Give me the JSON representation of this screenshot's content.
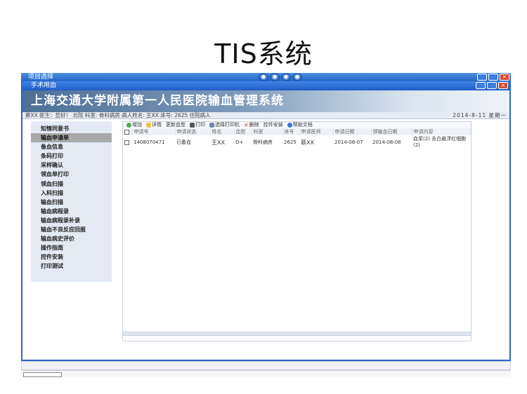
{
  "slide": {
    "title": "TIS系统"
  },
  "outer_window": {
    "title": "项目选择"
  },
  "inner_window": {
    "title": "手术用血"
  },
  "banner": {
    "text": "上海交通大学附属第一人民医院输血管理系统"
  },
  "infobar": {
    "text": "蔡XX 医生：您好！   北院  科室: 骨科病房  病人姓名: 王XX   床号: 2625  住院病人",
    "date": "2014-8-11 星期一"
  },
  "sidebar": {
    "items": [
      {
        "label": "知情同意书",
        "active": false
      },
      {
        "label": "输血申请单",
        "active": true
      },
      {
        "label": "备血信息",
        "active": false
      },
      {
        "label": "条码打印",
        "active": false
      },
      {
        "label": "采样确认",
        "active": false
      },
      {
        "label": "领血单打印",
        "active": false
      },
      {
        "label": "领血扫描",
        "active": false
      },
      {
        "label": "入科扫描",
        "active": false
      },
      {
        "label": "输血扫描",
        "active": false
      },
      {
        "label": "输血病程录",
        "active": false
      },
      {
        "label": "输血病程录补录",
        "active": false
      },
      {
        "label": "输血不良反应回报",
        "active": false
      },
      {
        "label": "输血病史评价",
        "active": false
      },
      {
        "label": "操作指南",
        "active": false
      },
      {
        "label": "控件安装",
        "active": false
      },
      {
        "label": "打印测试",
        "active": false
      }
    ]
  },
  "toolbar": {
    "add": "增加",
    "detail": "详情",
    "update_blood": "更新血型",
    "print": "打印",
    "select_printer": "选择打印机",
    "delete": "删除",
    "install": "控件安装",
    "help": "帮助文档"
  },
  "table": {
    "columns": [
      "申请号",
      "申请状态",
      "姓名",
      "血型",
      "科室",
      "床号",
      "申请医师",
      "申请日期",
      "预输血日期",
      "申请内容"
    ],
    "rows": [
      {
        "id": "1408070471",
        "status": "已备血",
        "name": "王XX",
        "blood_type": "O+",
        "dept": "骨科病房",
        "bed": "2625",
        "doctor": "蔡XX",
        "apply_date": "2014-08-07",
        "transfusion_date": "2014-08-08",
        "content": "血浆(2) 去白悬浮红细胞(2)"
      }
    ]
  },
  "colors": {
    "titlebar": "#2565c8",
    "banner_start": "#4d6f96",
    "sidebar_bg": "#e3eaf3",
    "active_item": "#a9a9a9"
  }
}
